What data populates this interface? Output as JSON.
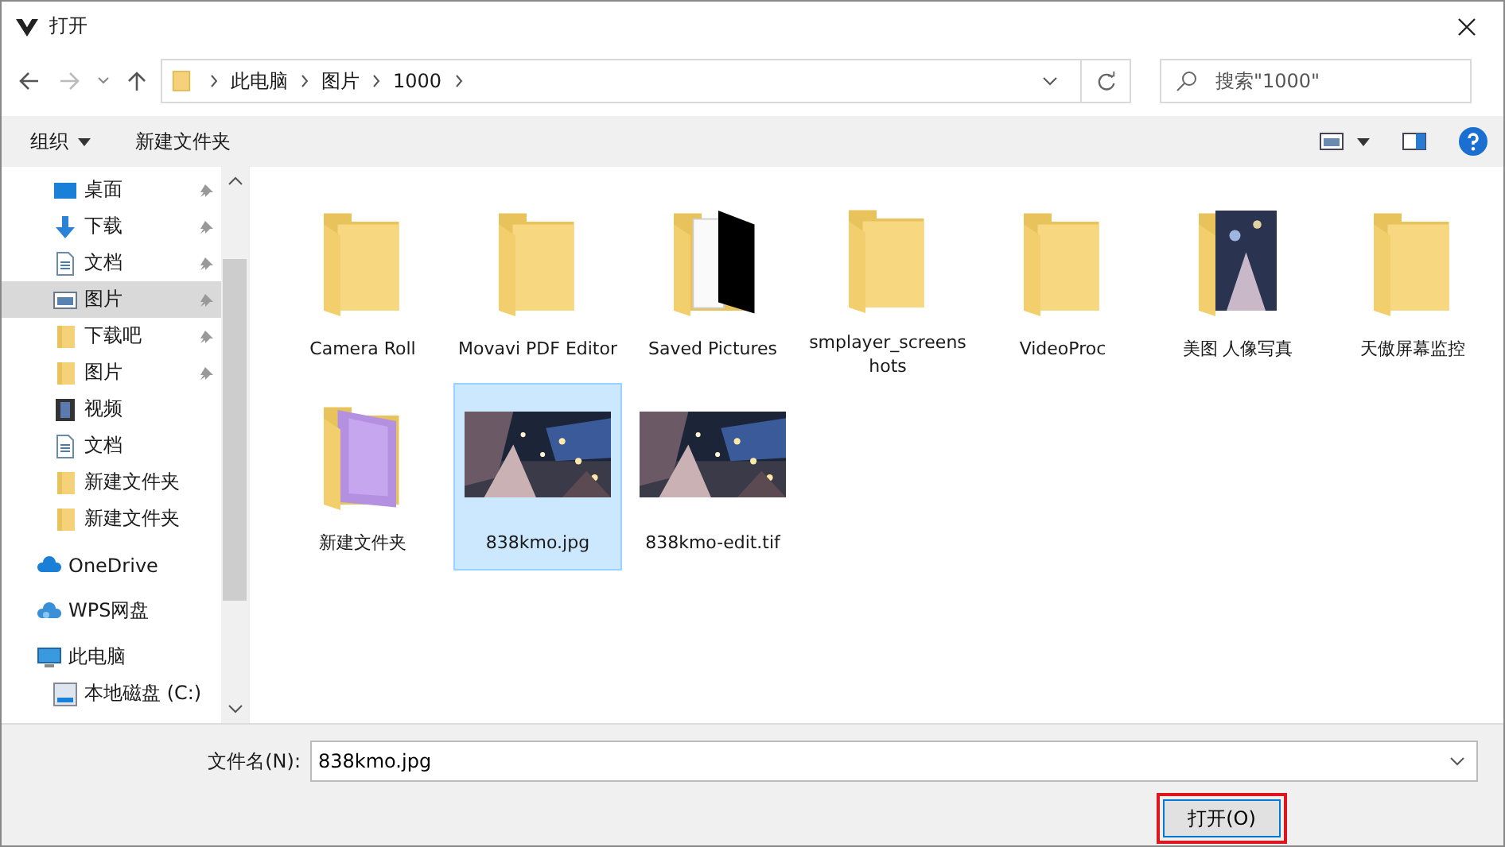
{
  "window": {
    "title": "打开"
  },
  "address": {
    "path": [
      "此电脑",
      "图片",
      "1000"
    ],
    "search_placeholder": "搜索\"1000\""
  },
  "toolbar": {
    "organize": "组织",
    "new_folder": "新建文件夹"
  },
  "sidebar": {
    "quick_access": [
      {
        "label": "桌面",
        "kind": "desktop",
        "pinned": true,
        "selected": false
      },
      {
        "label": "下载",
        "kind": "download",
        "pinned": true,
        "selected": false
      },
      {
        "label": "文档",
        "kind": "document",
        "pinned": true,
        "selected": false
      },
      {
        "label": "图片",
        "kind": "pictures",
        "pinned": true,
        "selected": true
      },
      {
        "label": "下载吧",
        "kind": "folder",
        "pinned": true,
        "selected": false
      },
      {
        "label": "图片",
        "kind": "folder",
        "pinned": true,
        "selected": false
      },
      {
        "label": "视频",
        "kind": "video",
        "pinned": false,
        "selected": false
      },
      {
        "label": "文档",
        "kind": "document",
        "pinned": false,
        "selected": false
      },
      {
        "label": "新建文件夹",
        "kind": "folder",
        "pinned": false,
        "selected": false
      },
      {
        "label": "新建文件夹",
        "kind": "folder",
        "pinned": false,
        "selected": false
      }
    ],
    "locations": [
      {
        "label": "OneDrive",
        "kind": "cloud"
      },
      {
        "label": "WPS网盘",
        "kind": "cloud2"
      },
      {
        "label": "此电脑",
        "kind": "pc",
        "children": [
          {
            "label": "本地磁盘 (C:)",
            "kind": "drive"
          }
        ]
      }
    ]
  },
  "files": [
    {
      "name": "Camera Roll",
      "kind": "folder",
      "selected": false
    },
    {
      "name": "Movavi PDF Editor",
      "kind": "folder",
      "selected": false
    },
    {
      "name": "Saved Pictures",
      "kind": "folder-doc",
      "selected": false
    },
    {
      "name": "smplayer_screenshots",
      "kind": "folder",
      "selected": false
    },
    {
      "name": "VideoProc",
      "kind": "folder",
      "selected": false
    },
    {
      "name": "美图 人像写真",
      "kind": "folder-photo",
      "selected": false
    },
    {
      "name": "天傲屏幕监控",
      "kind": "folder",
      "selected": false
    },
    {
      "name": "新建文件夹",
      "kind": "folder-tinted",
      "selected": false
    },
    {
      "name": "838kmo.jpg",
      "selected": true
    },
    {
      "name": "838kmo-edit.tif",
      "selected": false
    }
  ],
  "footer": {
    "filename_label": "文件名(N):",
    "filename": "838kmo.jpg",
    "open_button": "打开(O)",
    "open_highlighted": true
  }
}
